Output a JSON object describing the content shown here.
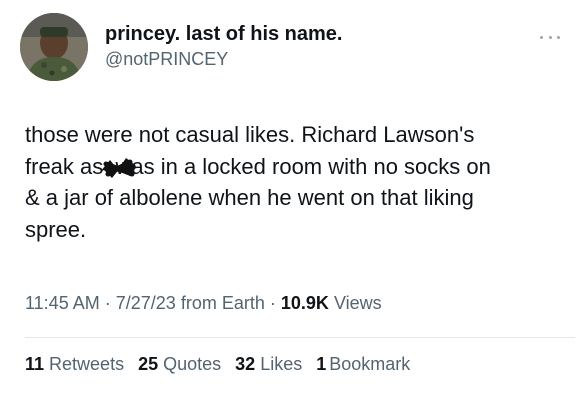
{
  "author": {
    "display_name": "princey. last of his name.",
    "handle": "@notPRINCEY"
  },
  "tweet": {
    "text": "those were not casual likes. Richard Lawson's\nfreak as  was in a locked room with no socks on\n& a jar of albolene when he went on that liking\nspree."
  },
  "meta": {
    "time": "11:45 AM",
    "separator": "·",
    "date": "7/27/23",
    "source": "from Earth",
    "views_count": "10.9K",
    "views_label": "Views"
  },
  "stats": {
    "retweets_count": "11",
    "retweets_label": "Retweets",
    "quotes_count": "25",
    "quotes_label": "Quotes",
    "likes_count": "32",
    "likes_label": "Likes",
    "bookmarks_count": "1",
    "bookmarks_label": "Bookmark"
  },
  "colors": {
    "text_primary": "#0f1419",
    "text_secondary": "#536471",
    "divider": "#e3e7ea"
  },
  "icons": {
    "more": "more-options-icon"
  }
}
